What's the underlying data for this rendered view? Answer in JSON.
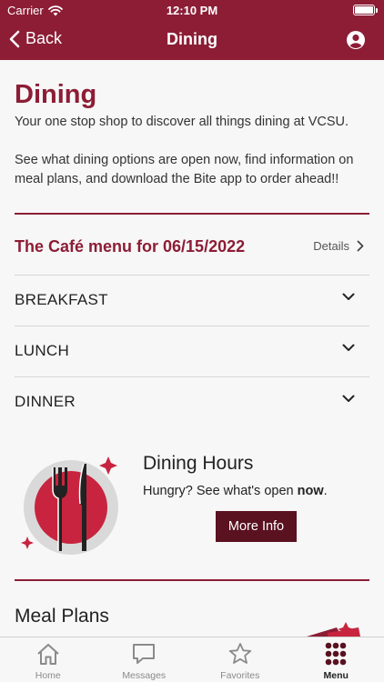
{
  "status": {
    "carrier": "Carrier",
    "time": "12:10 PM"
  },
  "nav": {
    "back_label": "Back",
    "title": "Dining"
  },
  "page": {
    "title": "Dining",
    "intro_1": "Your one stop shop to discover all things dining at VCSU.",
    "intro_2": "See what dining options are open now, find information on meal plans, and download the Bite app to order ahead!!"
  },
  "menu": {
    "title": "The Café menu for 06/15/2022",
    "details_label": "Details",
    "meals": [
      "BREAKFAST",
      "LUNCH",
      "DINNER"
    ]
  },
  "hours": {
    "title": "Dining Hours",
    "text_prefix": "Hungry? See what's open ",
    "text_bold": "now",
    "text_suffix": ".",
    "button_label": "More Info"
  },
  "meal_plans": {
    "title": "Meal Plans"
  },
  "tabs": [
    {
      "label": "Home",
      "icon": "home-icon",
      "active": false
    },
    {
      "label": "Messages",
      "icon": "messages-icon",
      "active": false
    },
    {
      "label": "Favorites",
      "icon": "star-icon",
      "active": false
    },
    {
      "label": "Menu",
      "icon": "grid-icon",
      "active": true
    }
  ],
  "colors": {
    "brand": "#8c1d35",
    "button": "#5a1120",
    "accent_red": "#c8243f"
  }
}
